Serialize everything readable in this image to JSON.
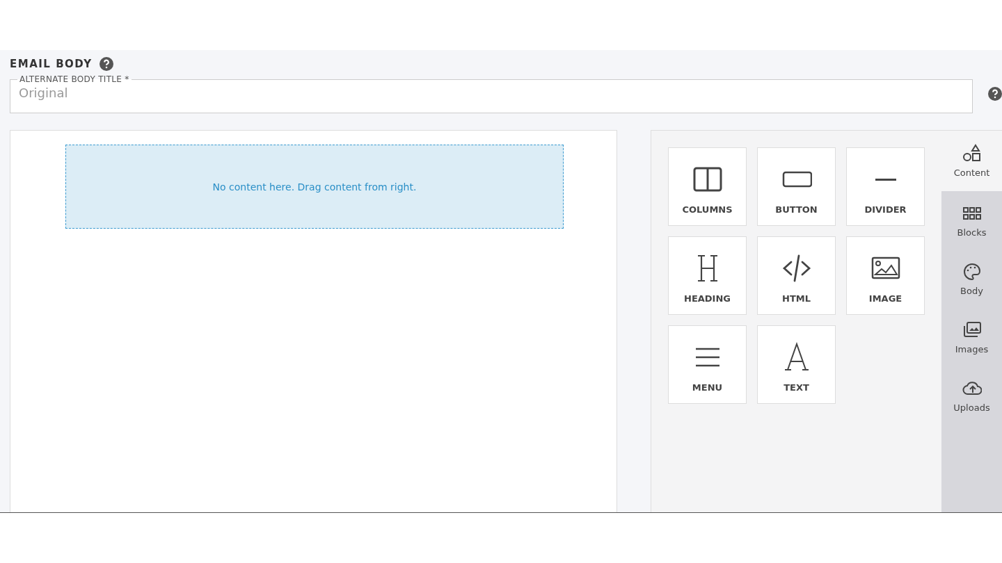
{
  "section": {
    "title": "EMAIL BODY"
  },
  "title_field": {
    "label": "ALTERNATE BODY TITLE *",
    "placeholder": "Original"
  },
  "canvas": {
    "drop_zone_text": "No content here. Drag content from right."
  },
  "tools": [
    {
      "label": "COLUMNS",
      "kind": "columns"
    },
    {
      "label": "BUTTON",
      "kind": "button"
    },
    {
      "label": "DIVIDER",
      "kind": "divider"
    },
    {
      "label": "HEADING",
      "kind": "heading"
    },
    {
      "label": "HTML",
      "kind": "html"
    },
    {
      "label": "IMAGE",
      "kind": "image"
    },
    {
      "label": "MENU",
      "kind": "menu"
    },
    {
      "label": "TEXT",
      "kind": "text"
    }
  ],
  "side_tabs": [
    {
      "label": "Content",
      "kind": "content",
      "selected": true
    },
    {
      "label": "Blocks",
      "kind": "blocks",
      "selected": false
    },
    {
      "label": "Body",
      "kind": "body",
      "selected": false
    },
    {
      "label": "Images",
      "kind": "images",
      "selected": false
    },
    {
      "label": "Uploads",
      "kind": "uploads",
      "selected": false
    }
  ]
}
